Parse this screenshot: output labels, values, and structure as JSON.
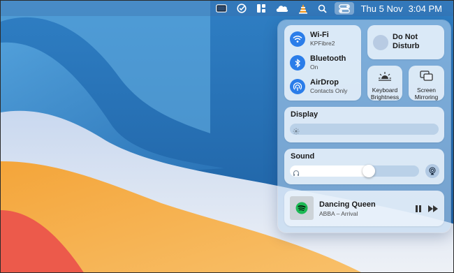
{
  "menubar": {
    "date": "Thu 5 Nov",
    "time": "3:04 PM",
    "icons": [
      "display-icon",
      "checkmark-circle-icon",
      "dashboard-icon",
      "cloud-icon",
      "vlc-cone-icon",
      "search-icon",
      "control-center-icon"
    ]
  },
  "control_center": {
    "connectivity": {
      "wifi": {
        "title": "Wi-Fi",
        "subtitle": "KPFibre2",
        "icon": "wifi-icon",
        "active": true
      },
      "bluetooth": {
        "title": "Bluetooth",
        "subtitle": "On",
        "icon": "bluetooth-icon",
        "active": true
      },
      "airdrop": {
        "title": "AirDrop",
        "subtitle": "Contacts Only",
        "icon": "airdrop-icon",
        "active": true
      }
    },
    "do_not_disturb": {
      "line1": "Do Not",
      "line2": "Disturb",
      "icon": "moon-icon"
    },
    "keyboard_brightness": {
      "line1": "Keyboard",
      "line2": "Brightness",
      "icon": "keyboard-brightness-icon"
    },
    "screen_mirroring": {
      "line1": "Screen",
      "line2": "Mirroring",
      "icon": "screen-mirroring-icon"
    },
    "display": {
      "title": "Display",
      "brightness_fraction": 0.02
    },
    "sound": {
      "title": "Sound",
      "volume_fraction": 0.66
    },
    "now_playing": {
      "title": "Dancing Queen",
      "subtitle": "ABBA – Arrival",
      "app_icon": "spotify-icon"
    }
  },
  "colors": {
    "accent": "#2b7de9",
    "spotify": "#1db954"
  }
}
